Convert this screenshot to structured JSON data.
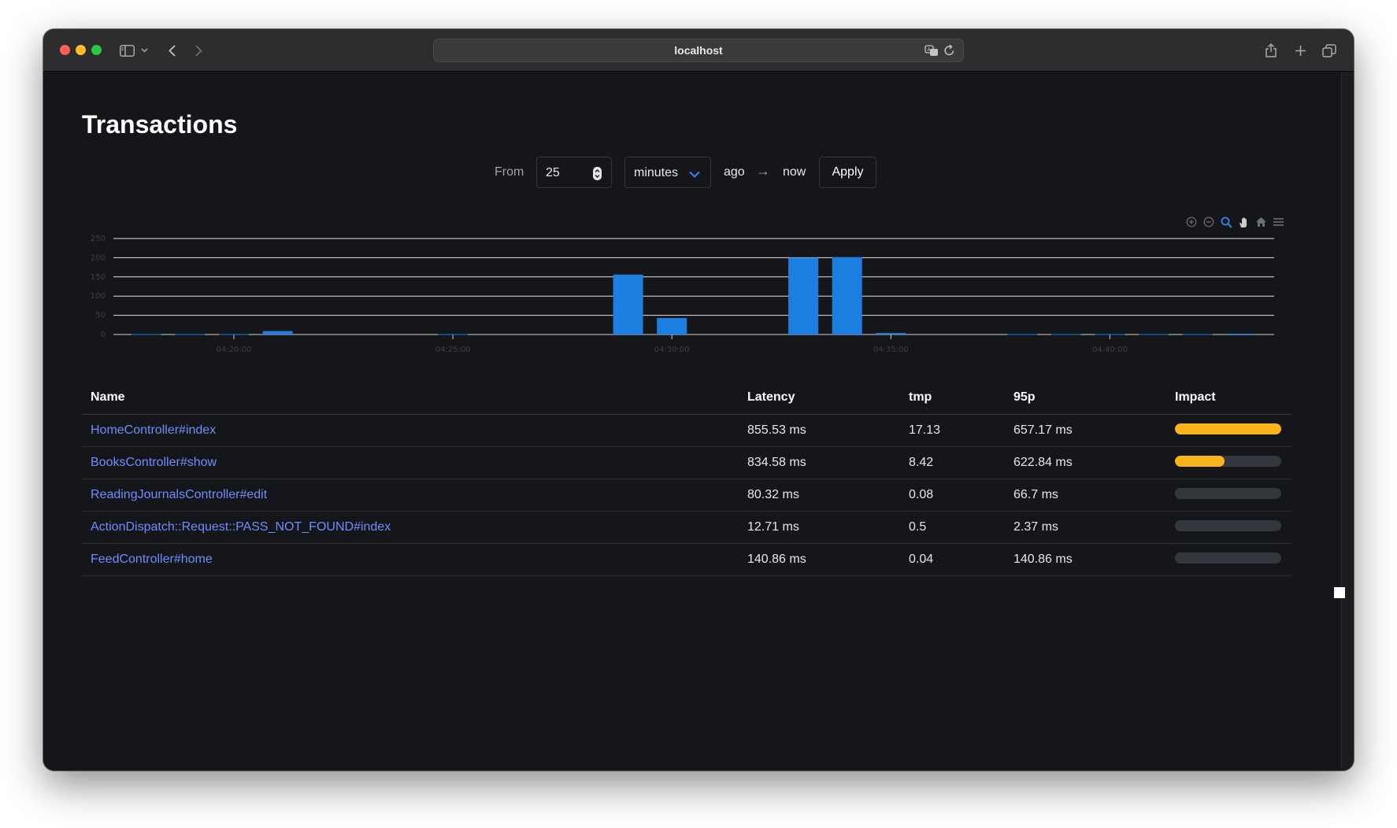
{
  "browser": {
    "url": "localhost"
  },
  "page": {
    "title": "Transactions"
  },
  "range": {
    "from_label": "From",
    "amount": "25",
    "unit": "minutes",
    "ago_label": "ago",
    "arrow": "→",
    "now_label": "now",
    "apply_label": "Apply"
  },
  "chart_toolbar": [
    "zoom-in-icon",
    "zoom-out-icon",
    "selection-zoom-icon",
    "pan-hand-icon",
    "reset-home-icon",
    "menu-icon"
  ],
  "colors": {
    "bar": "#1a7fe0",
    "impact_fill": "#fbb41c",
    "link": "#6f8dff",
    "background": "#151619"
  },
  "chart_data": {
    "type": "bar",
    "x_unit": "time",
    "xlim": [
      "04:17:15",
      "04:43:45"
    ],
    "ylim": [
      0,
      250
    ],
    "y_ticks": [
      "250",
      "200",
      "150",
      "100",
      "50",
      "0"
    ],
    "x_ticks": [
      "04:20:00",
      "04:25:00",
      "04:30:00",
      "04:35:00",
      "04:40:00"
    ],
    "grid": true,
    "series": [
      {
        "x": [
          "04:18:00",
          "04:19:00",
          "04:20:00",
          "04:21:00",
          "04:25:00",
          "04:29:00",
          "04:30:00",
          "04:33:00",
          "04:34:00",
          "04:35:00",
          "04:38:00",
          "04:39:00",
          "04:40:00",
          "04:41:00",
          "04:42:00",
          "04:43:00"
        ],
        "values": [
          1,
          1,
          1,
          9,
          1,
          156,
          43,
          200,
          201,
          4,
          1,
          1,
          1,
          1,
          1,
          2
        ]
      }
    ]
  },
  "table": {
    "headers": [
      "Name",
      "Latency",
      "tmp",
      "95p",
      "Impact"
    ],
    "rows": [
      {
        "name": "HomeController#index",
        "latency": "855.53 ms",
        "tmp": "17.13",
        "p95": "657.17 ms",
        "impact": 1.0
      },
      {
        "name": "BooksController#show",
        "latency": "834.58 ms",
        "tmp": "8.42",
        "p95": "622.84 ms",
        "impact": 0.47
      },
      {
        "name": "ReadingJournalsController#edit",
        "latency": "80.32 ms",
        "tmp": "0.08",
        "p95": "66.7 ms",
        "impact": 0.0
      },
      {
        "name": "ActionDispatch::Request::PASS_NOT_FOUND#index",
        "latency": "12.71 ms",
        "tmp": "0.5",
        "p95": "2.37 ms",
        "impact": 0.0
      },
      {
        "name": "FeedController#home",
        "latency": "140.86 ms",
        "tmp": "0.04",
        "p95": "140.86 ms",
        "impact": 0.0
      }
    ]
  }
}
